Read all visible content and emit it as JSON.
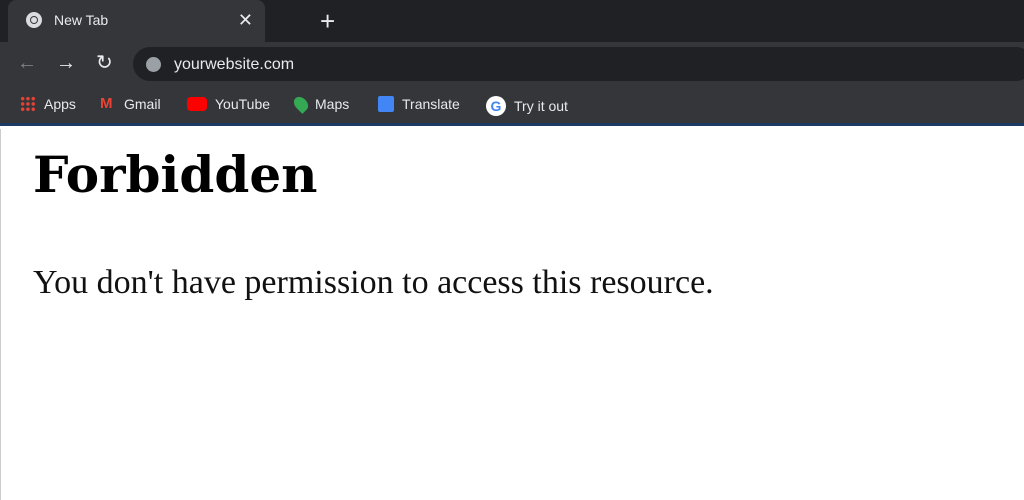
{
  "tab": {
    "title": "New Tab",
    "icon": "chrome-icon"
  },
  "address": {
    "url": "yourwebsite.com"
  },
  "bookmarks": [
    {
      "label": "Apps",
      "icon": "apps-grid-icon"
    },
    {
      "label": "Gmail",
      "icon": "gmail-icon"
    },
    {
      "label": "YouTube",
      "icon": "youtube-icon"
    },
    {
      "label": "Maps",
      "icon": "maps-icon"
    },
    {
      "label": "Translate",
      "icon": "translate-icon"
    },
    {
      "label": "Try it out",
      "icon": "google-icon"
    }
  ],
  "page": {
    "heading": "Forbidden",
    "message": "You don't have permission to access this resource."
  }
}
